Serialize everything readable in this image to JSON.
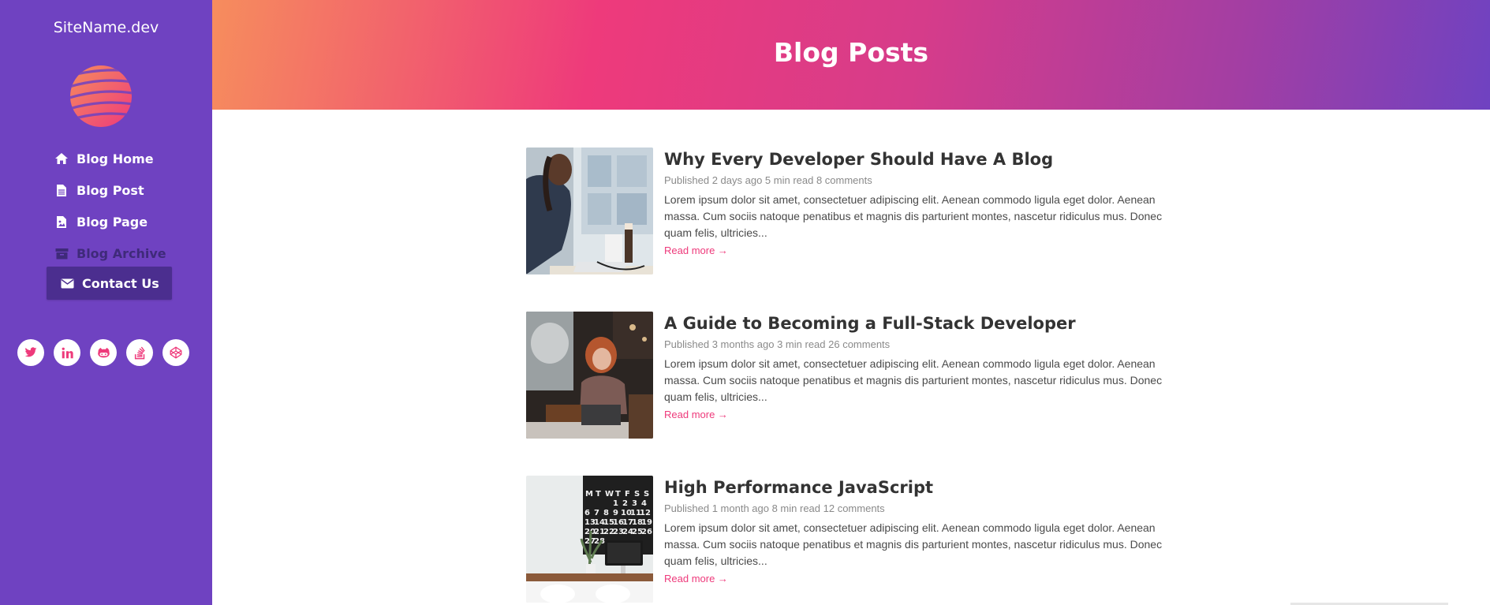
{
  "sidebar": {
    "site_name": "SiteName.dev",
    "nav": [
      {
        "label": "Blog Home",
        "icon": "home-icon"
      },
      {
        "label": "Blog Post",
        "icon": "file-icon"
      },
      {
        "label": "Blog Page",
        "icon": "file-image-icon"
      },
      {
        "label": "Blog Archive",
        "icon": "archive-icon"
      },
      {
        "label": "Contact Us",
        "icon": "envelope-icon"
      }
    ],
    "socials": [
      "twitter-icon",
      "linkedin-icon",
      "github-icon",
      "stack-overflow-icon",
      "codepen-icon"
    ]
  },
  "header": {
    "title": "Blog Posts"
  },
  "posts": [
    {
      "title": "Why Every Developer Should Have A Blog",
      "meta": "Published 2 days ago 5 min read 8 comments",
      "excerpt": "Lorem ipsum dolor sit amet, consectetuer adipiscing elit. Aenean commodo ligula eget dolor. Aenean massa. Cum sociis natoque penatibus et magnis dis parturient montes, nascetur ridiculus mus. Donec quam felis, ultricies...",
      "read_more": "Read more →"
    },
    {
      "title": "A Guide to Becoming a Full-Stack Developer",
      "meta": "Published 3 months ago 3 min read 26 comments",
      "excerpt": "Lorem ipsum dolor sit amet, consectetuer adipiscing elit. Aenean commodo ligula eget dolor. Aenean massa. Cum sociis natoque penatibus et magnis dis parturient montes, nascetur ridiculus mus. Donec quam felis, ultricies...",
      "read_more": "Read more →"
    },
    {
      "title": "High Performance JavaScript",
      "meta": "Published 1 month ago 8 min read 12 comments",
      "excerpt": "Lorem ipsum dolor sit amet, consectetuer adipiscing elit. Aenean commodo ligula eget dolor. Aenean massa. Cum sociis natoque penatibus et magnis dis parturient montes, nascetur ridiculus mus. Donec quam felis, ultricies...",
      "read_more": "Read more →"
    }
  ],
  "colors": {
    "sidebar": "#6f42c1",
    "accent": "#ee3a7b",
    "gradient_start": "#f68d5d",
    "gradient_end": "#6f42c1"
  }
}
